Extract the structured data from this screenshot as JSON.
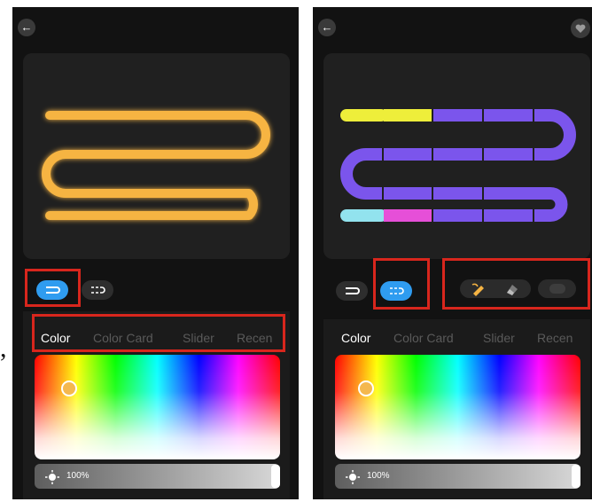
{
  "screens": [
    {
      "id": "single-color-mode",
      "tabs": [
        {
          "label": "Color",
          "active": true
        },
        {
          "label": "Color Card",
          "active": false
        },
        {
          "label": "Slider",
          "active": false
        },
        {
          "label": "Recen",
          "active": false
        }
      ],
      "active_mode": "single",
      "strip_color": "#f6b443",
      "brightness_label": "100%",
      "selected_color": "#f4b84e"
    },
    {
      "id": "segment-mode",
      "tabs": [
        {
          "label": "Color",
          "active": true
        },
        {
          "label": "Color Card",
          "active": false
        },
        {
          "label": "Slider",
          "active": false
        },
        {
          "label": "Recen",
          "active": false
        }
      ],
      "active_mode": "segment",
      "segment_colors": [
        "#eeee3a",
        "#eeee3a",
        "#7b55ec",
        "#7b55ec",
        "#7b55ec",
        "#7b55ec",
        "#7b55ec",
        "#7b55ec",
        "#7b55ec",
        "#7b55ec",
        "#7b55ec",
        "#7b55ec",
        "#7b55ec",
        "#7b55ec",
        "#7b55ec",
        "#7b55ec",
        "#92e3ee",
        "#e64fd8",
        "#7b55ec",
        "#7b55ec",
        "#7b55ec",
        "#7b55ec"
      ],
      "tools": [
        "paint-brush-icon",
        "eraser-icon",
        "toggle-switch-icon"
      ],
      "brightness_label": "100%",
      "selected_color": "#f4b84e"
    }
  ],
  "separator_text": ","
}
